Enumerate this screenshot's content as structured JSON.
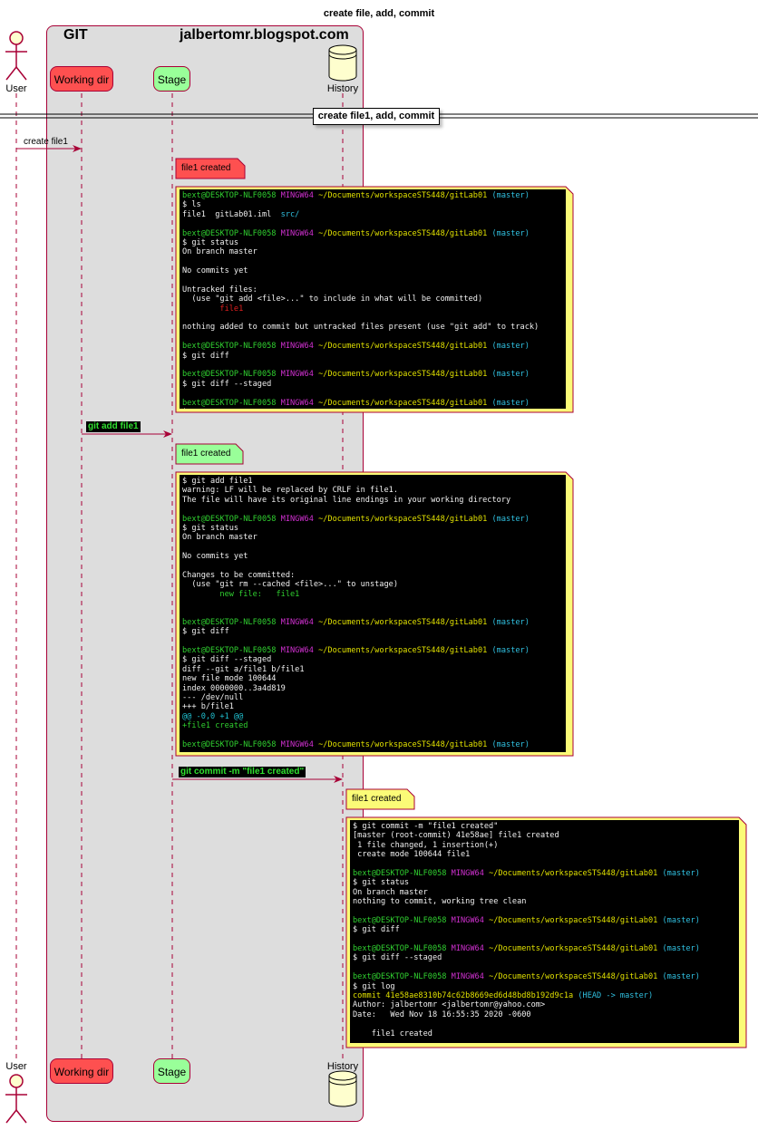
{
  "title": "create file, add, commit",
  "box": {
    "left_label": "GIT",
    "right_label": "jalbertomr.blogspot.com"
  },
  "participants": {
    "user": "User",
    "workdir": "Working dir",
    "stage": "Stage",
    "history": "History"
  },
  "divider": "create file1, add, commit",
  "messages": {
    "create_file": "create file1",
    "git_add": "git add file1",
    "git_commit": "git commit -m \"file1 created\""
  },
  "notes": {
    "workdir_note": "file1 created",
    "stage_note": "file1 created",
    "history_note": "file1 created"
  },
  "colors": {
    "workdir": "#fe5050",
    "stage": "#99ff99",
    "history": "#fefece",
    "note": "#fbfb77",
    "border": "#a80036",
    "box": "#dddddd"
  },
  "terminal1": [
    [
      [
        "u",
        "bext@DESKTOP-NLF0058 "
      ],
      [
        "m",
        "MINGW64 "
      ],
      [
        "y",
        "~/Documents/workspaceSTS448/gitLab01 "
      ],
      [
        "b",
        "(master)"
      ]
    ],
    [
      [
        "w",
        "$ ls"
      ]
    ],
    [
      [
        "w",
        "file1  gitLab01.iml  "
      ],
      [
        "b",
        "src/"
      ]
    ],
    [
      [
        "w",
        ""
      ]
    ],
    [
      [
        "u",
        "bext@DESKTOP-NLF0058 "
      ],
      [
        "m",
        "MINGW64 "
      ],
      [
        "y",
        "~/Documents/workspaceSTS448/gitLab01 "
      ],
      [
        "b",
        "(master)"
      ]
    ],
    [
      [
        "w",
        "$ git status"
      ]
    ],
    [
      [
        "w",
        "On branch master"
      ]
    ],
    [
      [
        "w",
        ""
      ]
    ],
    [
      [
        "w",
        "No commits yet"
      ]
    ],
    [
      [
        "w",
        ""
      ]
    ],
    [
      [
        "w",
        "Untracked files:"
      ]
    ],
    [
      [
        "w",
        "  (use \"git add <file>...\" to include in what will be committed)"
      ]
    ],
    [
      [
        "r",
        "        file1"
      ]
    ],
    [
      [
        "w",
        ""
      ]
    ],
    [
      [
        "w",
        "nothing added to commit but untracked files present (use \"git add\" to track)"
      ]
    ],
    [
      [
        "w",
        ""
      ]
    ],
    [
      [
        "u",
        "bext@DESKTOP-NLF0058 "
      ],
      [
        "m",
        "MINGW64 "
      ],
      [
        "y",
        "~/Documents/workspaceSTS448/gitLab01 "
      ],
      [
        "b",
        "(master)"
      ]
    ],
    [
      [
        "w",
        "$ git diff"
      ]
    ],
    [
      [
        "w",
        ""
      ]
    ],
    [
      [
        "u",
        "bext@DESKTOP-NLF0058 "
      ],
      [
        "m",
        "MINGW64 "
      ],
      [
        "y",
        "~/Documents/workspaceSTS448/gitLab01 "
      ],
      [
        "b",
        "(master)"
      ]
    ],
    [
      [
        "w",
        "$ git diff --staged"
      ]
    ],
    [
      [
        "w",
        ""
      ]
    ],
    [
      [
        "u",
        "bext@DESKTOP-NLF0058 "
      ],
      [
        "m",
        "MINGW64 "
      ],
      [
        "y",
        "~/Documents/workspaceSTS448/gitLab01 "
      ],
      [
        "b",
        "(master)"
      ]
    ],
    [
      [
        "w",
        "$"
      ]
    ]
  ],
  "terminal2": [
    [
      [
        "w",
        "$ git add file1"
      ]
    ],
    [
      [
        "w",
        "warning: LF will be replaced by CRLF in file1."
      ]
    ],
    [
      [
        "w",
        "The file will have its original line endings in your working directory"
      ]
    ],
    [
      [
        "w",
        ""
      ]
    ],
    [
      [
        "u",
        "bext@DESKTOP-NLF0058 "
      ],
      [
        "m",
        "MINGW64 "
      ],
      [
        "y",
        "~/Documents/workspaceSTS448/gitLab01 "
      ],
      [
        "b",
        "(master)"
      ]
    ],
    [
      [
        "w",
        "$ git status"
      ]
    ],
    [
      [
        "w",
        "On branch master"
      ]
    ],
    [
      [
        "w",
        ""
      ]
    ],
    [
      [
        "w",
        "No commits yet"
      ]
    ],
    [
      [
        "w",
        ""
      ]
    ],
    [
      [
        "w",
        "Changes to be committed:"
      ]
    ],
    [
      [
        "w",
        "  (use \"git rm --cached <file>...\" to unstage)"
      ]
    ],
    [
      [
        "g",
        "        new file:   file1"
      ]
    ],
    [
      [
        "w",
        ""
      ]
    ],
    [
      [
        "w",
        ""
      ]
    ],
    [
      [
        "u",
        "bext@DESKTOP-NLF0058 "
      ],
      [
        "m",
        "MINGW64 "
      ],
      [
        "y",
        "~/Documents/workspaceSTS448/gitLab01 "
      ],
      [
        "b",
        "(master)"
      ]
    ],
    [
      [
        "w",
        "$ git diff"
      ]
    ],
    [
      [
        "w",
        ""
      ]
    ],
    [
      [
        "u",
        "bext@DESKTOP-NLF0058 "
      ],
      [
        "m",
        "MINGW64 "
      ],
      [
        "y",
        "~/Documents/workspaceSTS448/gitLab01 "
      ],
      [
        "b",
        "(master)"
      ]
    ],
    [
      [
        "w",
        "$ git diff --staged"
      ]
    ],
    [
      [
        "w",
        "diff --git a/file1 b/file1"
      ]
    ],
    [
      [
        "w",
        "new file mode 100644"
      ]
    ],
    [
      [
        "w",
        "index 0000000..3a4d819"
      ]
    ],
    [
      [
        "w",
        "--- /dev/null"
      ]
    ],
    [
      [
        "w",
        "+++ b/file1"
      ]
    ],
    [
      [
        "c",
        "@@ -0,0 +1 @@"
      ]
    ],
    [
      [
        "g",
        "+file1 created"
      ]
    ],
    [
      [
        "w",
        ""
      ]
    ],
    [
      [
        "u",
        "bext@DESKTOP-NLF0058 "
      ],
      [
        "m",
        "MINGW64 "
      ],
      [
        "y",
        "~/Documents/workspaceSTS448/gitLab01 "
      ],
      [
        "b",
        "(master)"
      ]
    ]
  ],
  "terminal3": [
    [
      [
        "w",
        "$ git commit -m \"file1 created\""
      ]
    ],
    [
      [
        "w",
        "[master (root-commit) 41e58ae] file1 created"
      ]
    ],
    [
      [
        "w",
        " 1 file changed, 1 insertion(+)"
      ]
    ],
    [
      [
        "w",
        " create mode 100644 file1"
      ]
    ],
    [
      [
        "w",
        ""
      ]
    ],
    [
      [
        "u",
        "bext@DESKTOP-NLF0058 "
      ],
      [
        "m",
        "MINGW64 "
      ],
      [
        "y",
        "~/Documents/workspaceSTS448/gitLab01 "
      ],
      [
        "b",
        "(master)"
      ]
    ],
    [
      [
        "w",
        "$ git status"
      ]
    ],
    [
      [
        "w",
        "On branch master"
      ]
    ],
    [
      [
        "w",
        "nothing to commit, working tree clean"
      ]
    ],
    [
      [
        "w",
        ""
      ]
    ],
    [
      [
        "u",
        "bext@DESKTOP-NLF0058 "
      ],
      [
        "m",
        "MINGW64 "
      ],
      [
        "y",
        "~/Documents/workspaceSTS448/gitLab01 "
      ],
      [
        "b",
        "(master)"
      ]
    ],
    [
      [
        "w",
        "$ git diff"
      ]
    ],
    [
      [
        "w",
        ""
      ]
    ],
    [
      [
        "u",
        "bext@DESKTOP-NLF0058 "
      ],
      [
        "m",
        "MINGW64 "
      ],
      [
        "y",
        "~/Documents/workspaceSTS448/gitLab01 "
      ],
      [
        "b",
        "(master)"
      ]
    ],
    [
      [
        "w",
        "$ git diff --staged"
      ]
    ],
    [
      [
        "w",
        ""
      ]
    ],
    [
      [
        "u",
        "bext@DESKTOP-NLF0058 "
      ],
      [
        "m",
        "MINGW64 "
      ],
      [
        "y",
        "~/Documents/workspaceSTS448/gitLab01 "
      ],
      [
        "b",
        "(master)"
      ]
    ],
    [
      [
        "w",
        "$ git log"
      ]
    ],
    [
      [
        "y",
        "commit 41e58ae8310b74c62b8669ed6d48bd8b192d9c1a "
      ],
      [
        "b",
        "(HEAD -> master)"
      ]
    ],
    [
      [
        "w",
        "Author: jalbertomr <jalbertomr@yahoo.com>"
      ]
    ],
    [
      [
        "w",
        "Date:   Wed Nov 18 16:55:35 2020 -0600"
      ]
    ],
    [
      [
        "w",
        ""
      ]
    ],
    [
      [
        "w",
        "    file1 created"
      ]
    ]
  ]
}
